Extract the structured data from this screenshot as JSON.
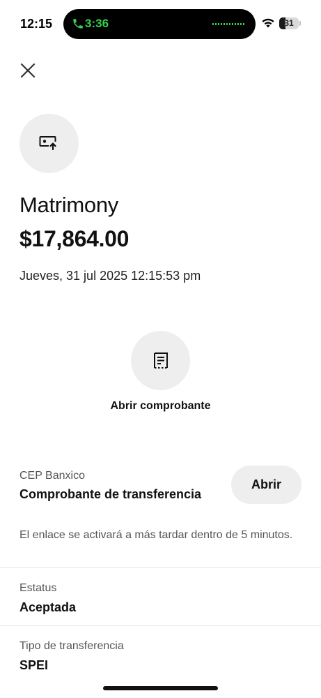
{
  "status_bar": {
    "time": "12:15",
    "call_duration": "3:36",
    "battery_level": "31",
    "battery_fraction": 0.31,
    "call_color": "#35d14e"
  },
  "header": {
    "close_icon": "close-icon"
  },
  "transfer": {
    "icon": "transfer-upload-icon",
    "payee": "Matrimony",
    "amount": "$17,864.00",
    "datetime": "Jueves, 31 jul 2025 12:15:53 pm"
  },
  "receipt": {
    "icon": "receipt-icon",
    "label": "Abrir comprobante"
  },
  "cep": {
    "label": "CEP Banxico",
    "value": "Comprobante de transferencia",
    "button_label": "Abrir",
    "notice": "El enlace se activará a más tardar dentro de 5 minutos."
  },
  "details": {
    "status_label": "Estatus",
    "status_value": "Aceptada",
    "type_label": "Tipo de transferencia",
    "type_value": "SPEI"
  }
}
